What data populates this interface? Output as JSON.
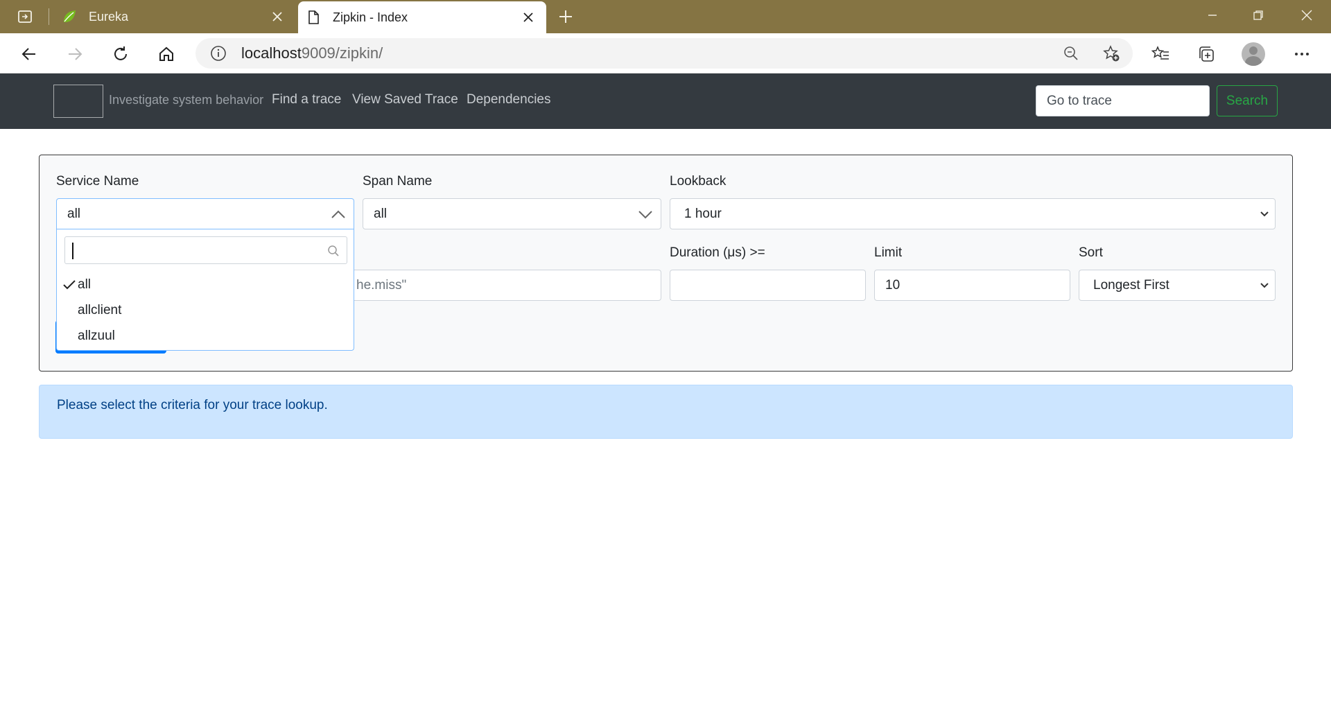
{
  "browser": {
    "tabs": [
      {
        "title": "Eureka",
        "active": false,
        "favicon": "spring-leaf-icon"
      },
      {
        "title": "Zipkin - Index",
        "active": true,
        "favicon": "page-icon"
      }
    ],
    "address": {
      "host": "localhost",
      "rest": "9009/zipkin/"
    }
  },
  "navbar": {
    "tagline": "Investigate system behavior",
    "links": [
      "Find a trace",
      "View Saved Trace",
      "Dependencies"
    ],
    "goto_placeholder": "Go to trace",
    "search_label": "Search",
    "search_color": "#28a745"
  },
  "form": {
    "service_name": {
      "label": "Service Name",
      "value": "all"
    },
    "span_name": {
      "label": "Span Name",
      "value": "all"
    },
    "lookback": {
      "label": "Lookback",
      "value": "1 hour"
    },
    "annotations_partial": "he.miss\"",
    "duration": {
      "label": "Duration (μs) >=",
      "value": ""
    },
    "limit": {
      "label": "Limit",
      "value": "10"
    },
    "sort": {
      "label": "Sort",
      "value": "Longest First"
    }
  },
  "service_dropdown": {
    "search_value": "",
    "options": [
      {
        "label": "all",
        "selected": true
      },
      {
        "label": "allclient",
        "selected": false
      },
      {
        "label": "allzuul",
        "selected": false
      }
    ]
  },
  "alert": {
    "message": "Please select the criteria for your trace lookup."
  }
}
